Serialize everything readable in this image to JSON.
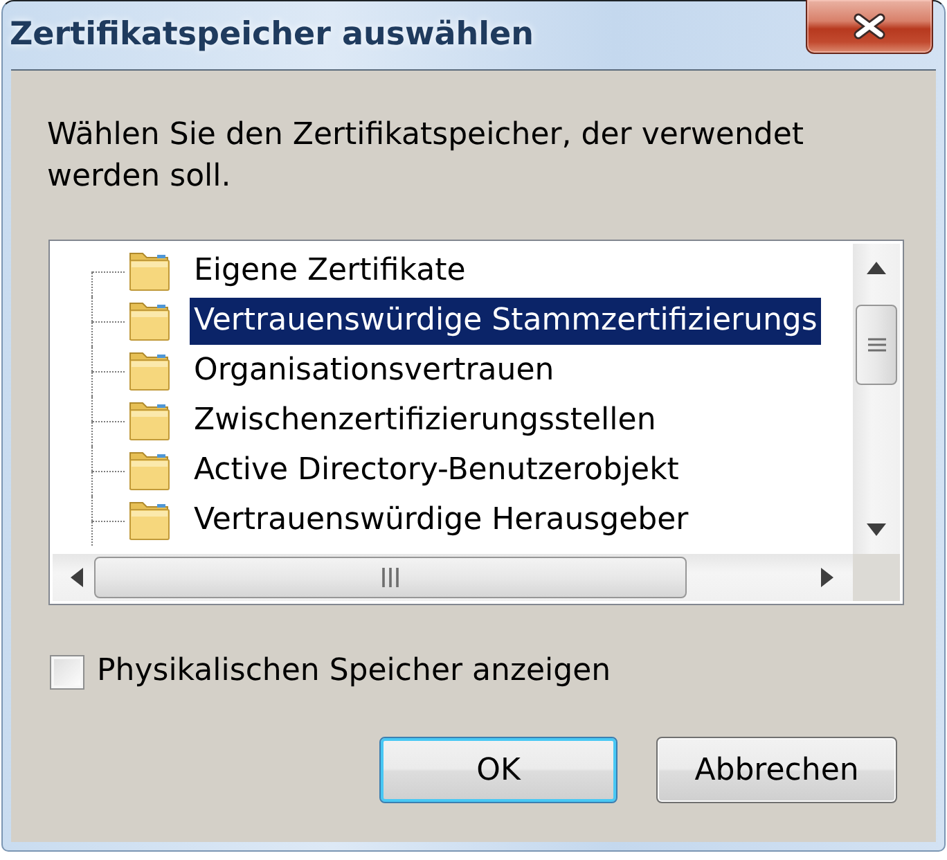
{
  "window": {
    "title": "Zertifikatspeicher auswählen"
  },
  "instruction": "Wählen Sie den Zertifikatspeicher, der verwendet werden soll.",
  "stores": [
    {
      "label": "Eigene Zertifikate",
      "selected": false
    },
    {
      "label": "Vertrauenswürdige Stammzertifizierungs",
      "selected": true
    },
    {
      "label": "Organisationsvertrauen",
      "selected": false
    },
    {
      "label": "Zwischenzertifizierungsstellen",
      "selected": false
    },
    {
      "label": "Active Directory-Benutzerobjekt",
      "selected": false
    },
    {
      "label": "Vertrauenswürdige Herausgeber",
      "selected": false
    }
  ],
  "physical_store_option": {
    "label": "Physikalischen Speicher anzeigen",
    "checked": false
  },
  "buttons": [
    {
      "label": "OK",
      "default": true
    },
    {
      "label": "Abbrechen",
      "default": false
    }
  ]
}
